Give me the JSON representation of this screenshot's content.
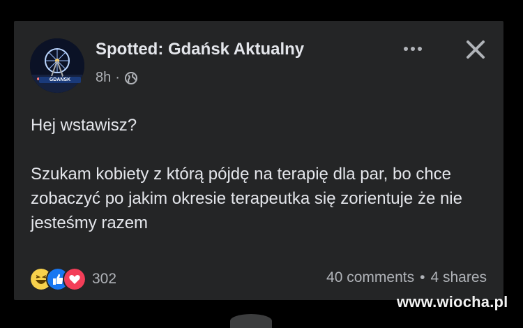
{
  "post": {
    "page_name": "Spotted: Gdańsk Aktualny",
    "time": "8h",
    "separator": "·",
    "audience_icon": "globe-icon",
    "more_icon": "more-dots-icon",
    "close_icon": "close-icon",
    "avatar_text": "GDAŃSK",
    "text_line1": "Hej wstawisz?",
    "text_para2": "Szukam kobiety z którą pójdę na terapię dla par, bo chce zobaczyć po jakim okresie terapeutka się zorientuje że nie jesteśmy razem",
    "reaction_icons": [
      "haha-icon",
      "like-icon",
      "love-icon"
    ],
    "reaction_count": "302",
    "comments": "40 comments",
    "stats_separator": "•",
    "shares": "4 shares"
  },
  "watermark": "www.wiocha.pl",
  "colors": {
    "card_bg": "#242526",
    "primary_text": "#e4e6eb",
    "secondary_text": "#b0b3b8",
    "like_blue": "#1877f2",
    "love_red": "#f33e58",
    "haha_yellow": "#f7d14c"
  }
}
